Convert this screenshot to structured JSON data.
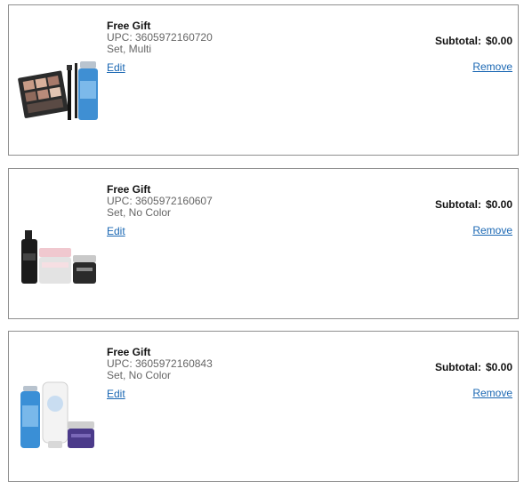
{
  "cart_items": [
    {
      "title": "Free Gift",
      "upc": "UPC: 3605972160720",
      "variant": "Set, Multi",
      "edit_label": "Edit",
      "subtotal_label": "Subtotal:",
      "subtotal_value": "$0.00",
      "remove_label": "Remove",
      "image": "eyeshadow-palette-mascara-makeup-remover-set"
    },
    {
      "title": "Free Gift",
      "upc": "UPC: 3605972160607",
      "variant": "Set, No Color",
      "edit_label": "Edit",
      "subtotal_label": "Subtotal:",
      "subtotal_value": "$0.00",
      "remove_label": "Remove",
      "image": "serum-moisturizer-eye-cream-set"
    },
    {
      "title": "Free Gift",
      "upc": "UPC: 3605972160843",
      "variant": "Set, No Color",
      "edit_label": "Edit",
      "subtotal_label": "Subtotal:",
      "subtotal_value": "$0.00",
      "remove_label": "Remove",
      "image": "toner-cleanser-night-cream-set"
    }
  ],
  "colors": {
    "link": "#1a67b3",
    "border": "#8f8f8f",
    "muted_text": "#666666"
  }
}
